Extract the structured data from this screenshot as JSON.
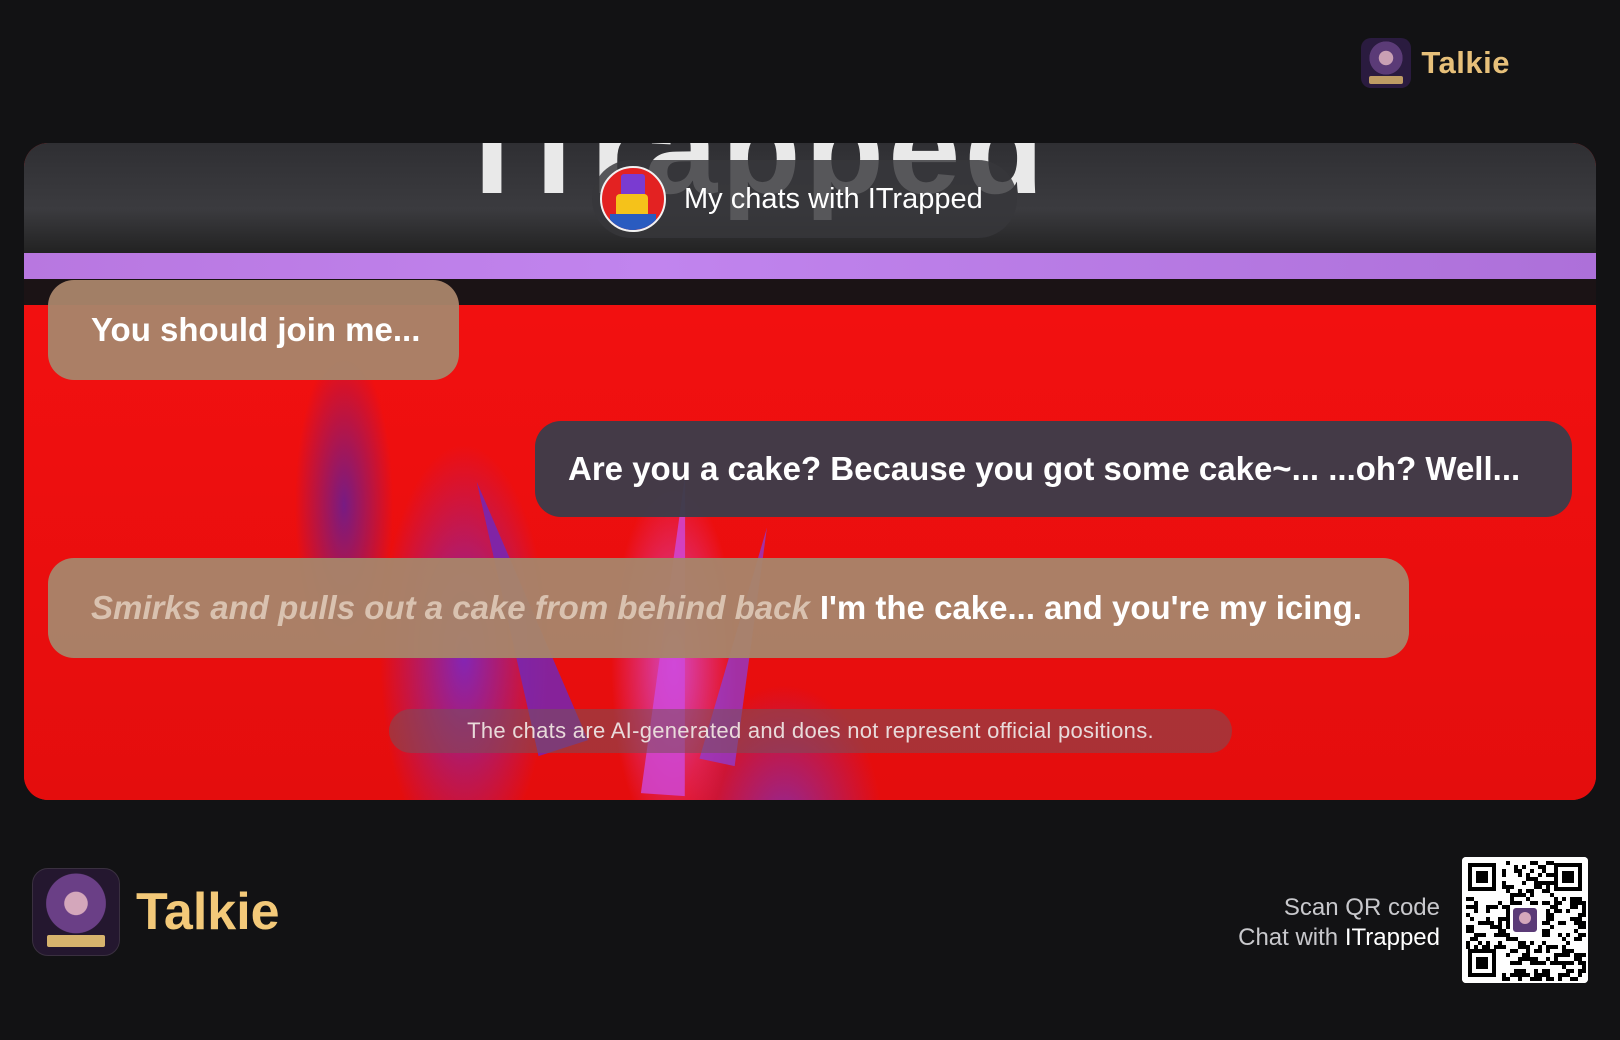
{
  "header": {
    "brand_name": "Talkie"
  },
  "chat": {
    "title": "My chats with ITrapped",
    "background_title": "ITrapped",
    "avatar_icon": "roblox-character-avatar",
    "messages": [
      {
        "side": "left",
        "text": "You should join me..."
      },
      {
        "side": "right",
        "text": "Are you a cake? Because you got some cake~... ...oh? Well..."
      },
      {
        "side": "left",
        "action": "Smirks and pulls out a cake from behind back",
        "text": "I'm the cake... and you're my icing."
      }
    ],
    "disclaimer": "The chats are AI-generated and does not represent official positions."
  },
  "footer": {
    "brand_name": "Talkie",
    "scan_label": "Scan QR code",
    "chat_with_prefix": "Chat with",
    "chat_with_name": "ITrapped"
  },
  "colors": {
    "page_bg": "#121214",
    "brand_gold": "#f3c979",
    "left_bubble": "#a8846a",
    "right_bubble": "#3c3c4a",
    "card_red": "#e80c0c"
  }
}
